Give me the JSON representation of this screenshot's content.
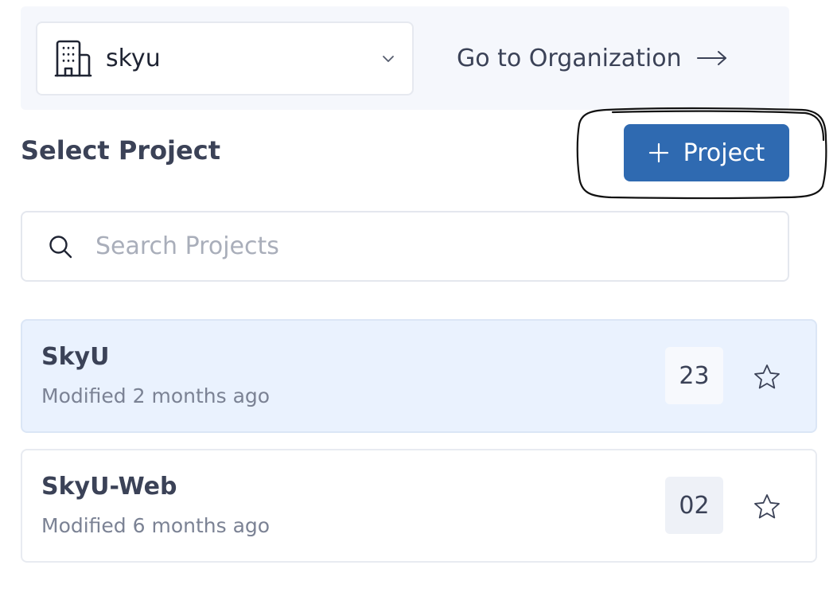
{
  "org": {
    "selected": "skyu",
    "goto_label": "Go to Organization"
  },
  "page": {
    "title": "Select Project",
    "add_button_label": "Project"
  },
  "search": {
    "placeholder": "Search Projects",
    "value": ""
  },
  "projects": [
    {
      "name": "SkyU",
      "modified": "Modified 2 months ago",
      "count": "23",
      "active": true,
      "starred": false
    },
    {
      "name": "SkyU-Web",
      "modified": "Modified 6 months ago",
      "count": "02",
      "active": false,
      "starred": false
    }
  ],
  "colors": {
    "primary": "#2f6ab1",
    "active_row": "#eaf2fe",
    "text": "#3b4257",
    "muted": "#7b8294"
  },
  "icons": {
    "org": "building-icon",
    "dropdown": "chevron-down-icon",
    "goto": "arrow-right-icon",
    "add": "plus-icon",
    "search": "search-icon",
    "favorite": "star-icon"
  }
}
